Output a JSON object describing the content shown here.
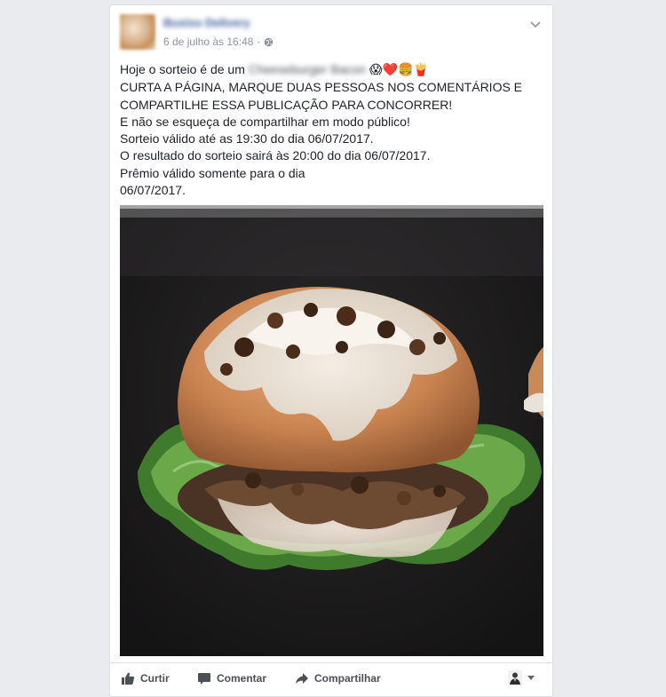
{
  "post": {
    "author_name": "Buxixo Delivery",
    "timestamp": "6 de julho às 16:48",
    "separator": "·",
    "privacy_icon": "globe-icon",
    "text_lines": [
      "CURTA A PÁGINA, MARQUE DUAS PESSOAS NOS COMENTÁRIOS E",
      "COMPARTILHE ESSA PUBLICAÇÃO PARA CONCORRER!",
      "E não se esqueça de compartilhar em modo público!",
      "Sorteio válido até as 19:30 do dia 06/07/2017.",
      "O resultado do sorteio sairá às 20:00 do dia 06/07/2017.",
      "Prêmio válido somente para o dia",
      "06/07/2017."
    ],
    "line1_prefix": "Hoje o sorteio é de um",
    "line1_blurred": "Cheeseburger Bacon",
    "line1_emojis": "😱❤️🍔🍟"
  },
  "actions": {
    "like": "Curtir",
    "comment": "Comentar",
    "share": "Compartilhar"
  },
  "colors": {
    "link": "#365899",
    "meta": "#90949c",
    "text": "#1d2129",
    "action": "#4b4f56",
    "background": "#e9ebee"
  }
}
